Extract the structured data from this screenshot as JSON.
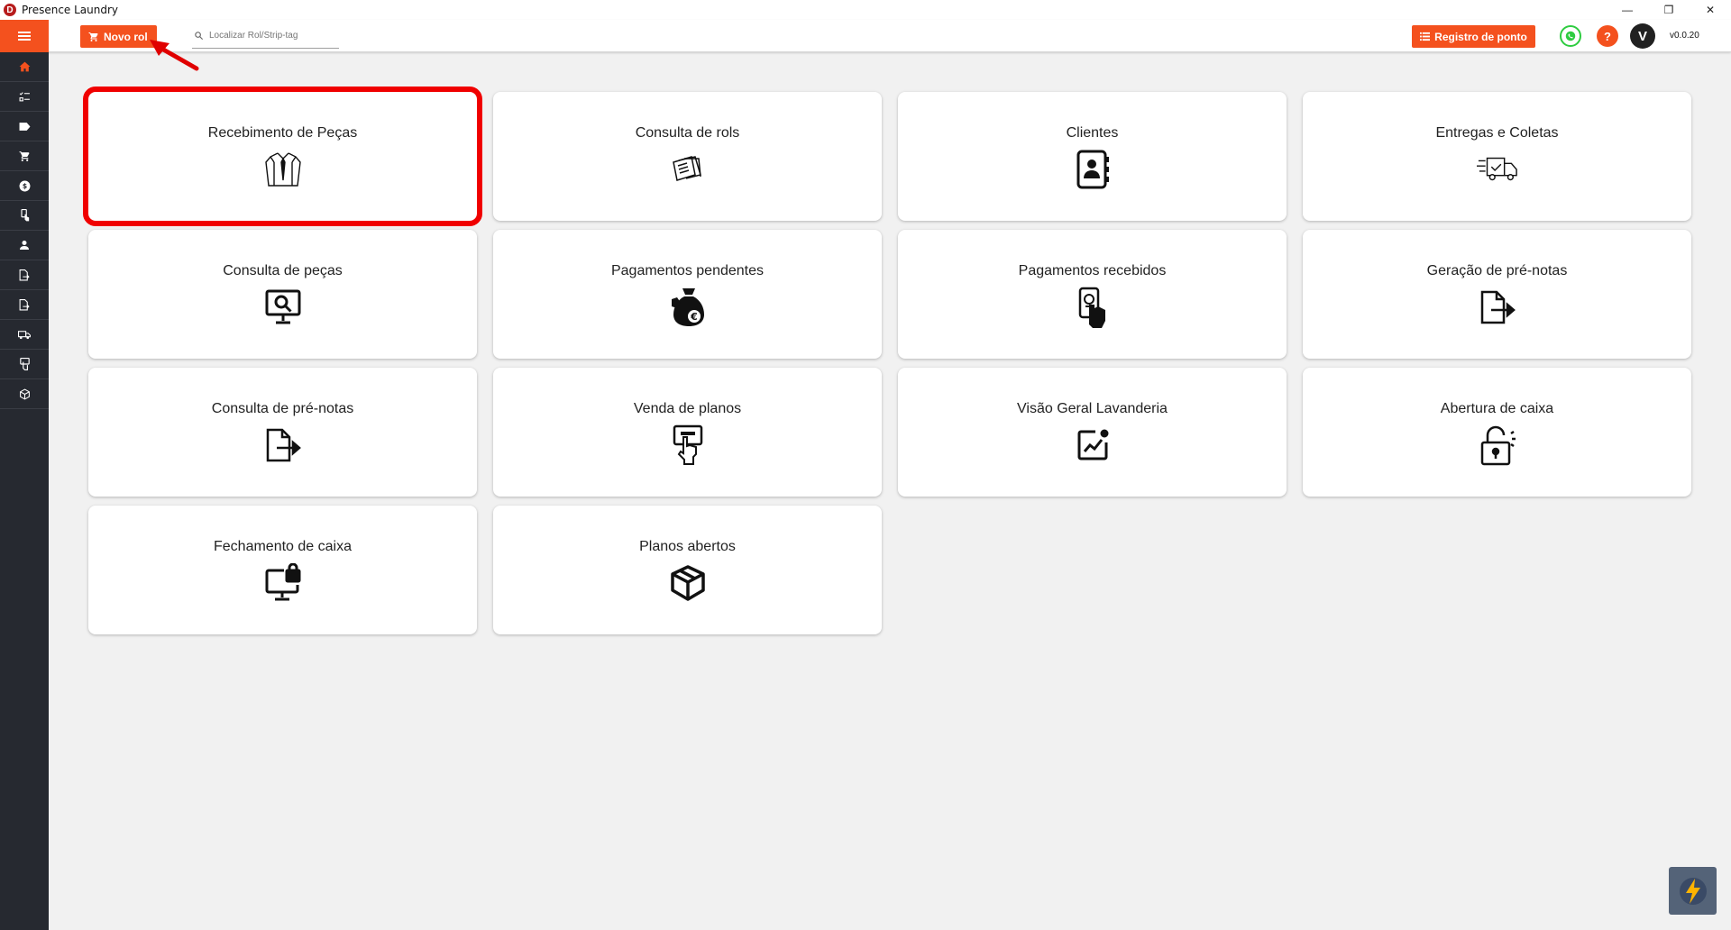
{
  "window": {
    "title": "Presence Laundry",
    "logo_letter": "D",
    "minimize": "—",
    "restore": "❐",
    "close": "✕"
  },
  "appbar": {
    "new_button_label": "Novo rol",
    "search_placeholder": "Localizar Rol/Strip-tag",
    "clock_button_label": "Registro de ponto",
    "help_label": "?",
    "avatar_letter": "V",
    "version": "v0.0.20",
    "accent_color": "#f4511e"
  },
  "sidebar": {
    "items": [
      {
        "icon": "menu-icon"
      },
      {
        "icon": "home-icon"
      },
      {
        "icon": "checklist-icon"
      },
      {
        "icon": "tag-icon"
      },
      {
        "icon": "cart-icon"
      },
      {
        "icon": "dollar-icon"
      },
      {
        "icon": "hand-pointer-icon"
      },
      {
        "icon": "person-icon"
      },
      {
        "icon": "document-arrow-icon"
      },
      {
        "icon": "document-arrow-icon"
      },
      {
        "icon": "truck-icon"
      },
      {
        "icon": "hand-card-icon"
      },
      {
        "icon": "box-icon"
      }
    ]
  },
  "cards": [
    {
      "label": "Recebimento de Peças",
      "icon": "shirt-icon",
      "highlighted": true
    },
    {
      "label": "Consulta de rols",
      "icon": "documents-icon"
    },
    {
      "label": "Clientes",
      "icon": "contacts-book-icon"
    },
    {
      "label": "Entregas e Coletas",
      "icon": "delivery-truck-icon"
    },
    {
      "label": "Consulta de peças",
      "icon": "monitor-search-icon"
    },
    {
      "label": "Pagamentos pendentes",
      "icon": "money-bag-euro-icon"
    },
    {
      "label": "Pagamentos recebidos",
      "icon": "phone-payment-icon"
    },
    {
      "label": "Geração de pré-notas",
      "icon": "file-export-icon"
    },
    {
      "label": "Consulta de pré-notas",
      "icon": "file-export-icon"
    },
    {
      "label": "Venda de planos",
      "icon": "hand-card-icon"
    },
    {
      "label": "Visão Geral Lavanderia",
      "icon": "chart-box-icon"
    },
    {
      "label": "Abertura de caixa",
      "icon": "unlock-icon"
    },
    {
      "label": "Fechamento de caixa",
      "icon": "monitor-lock-icon"
    },
    {
      "label": "Planos abertos",
      "icon": "box-icon"
    }
  ]
}
